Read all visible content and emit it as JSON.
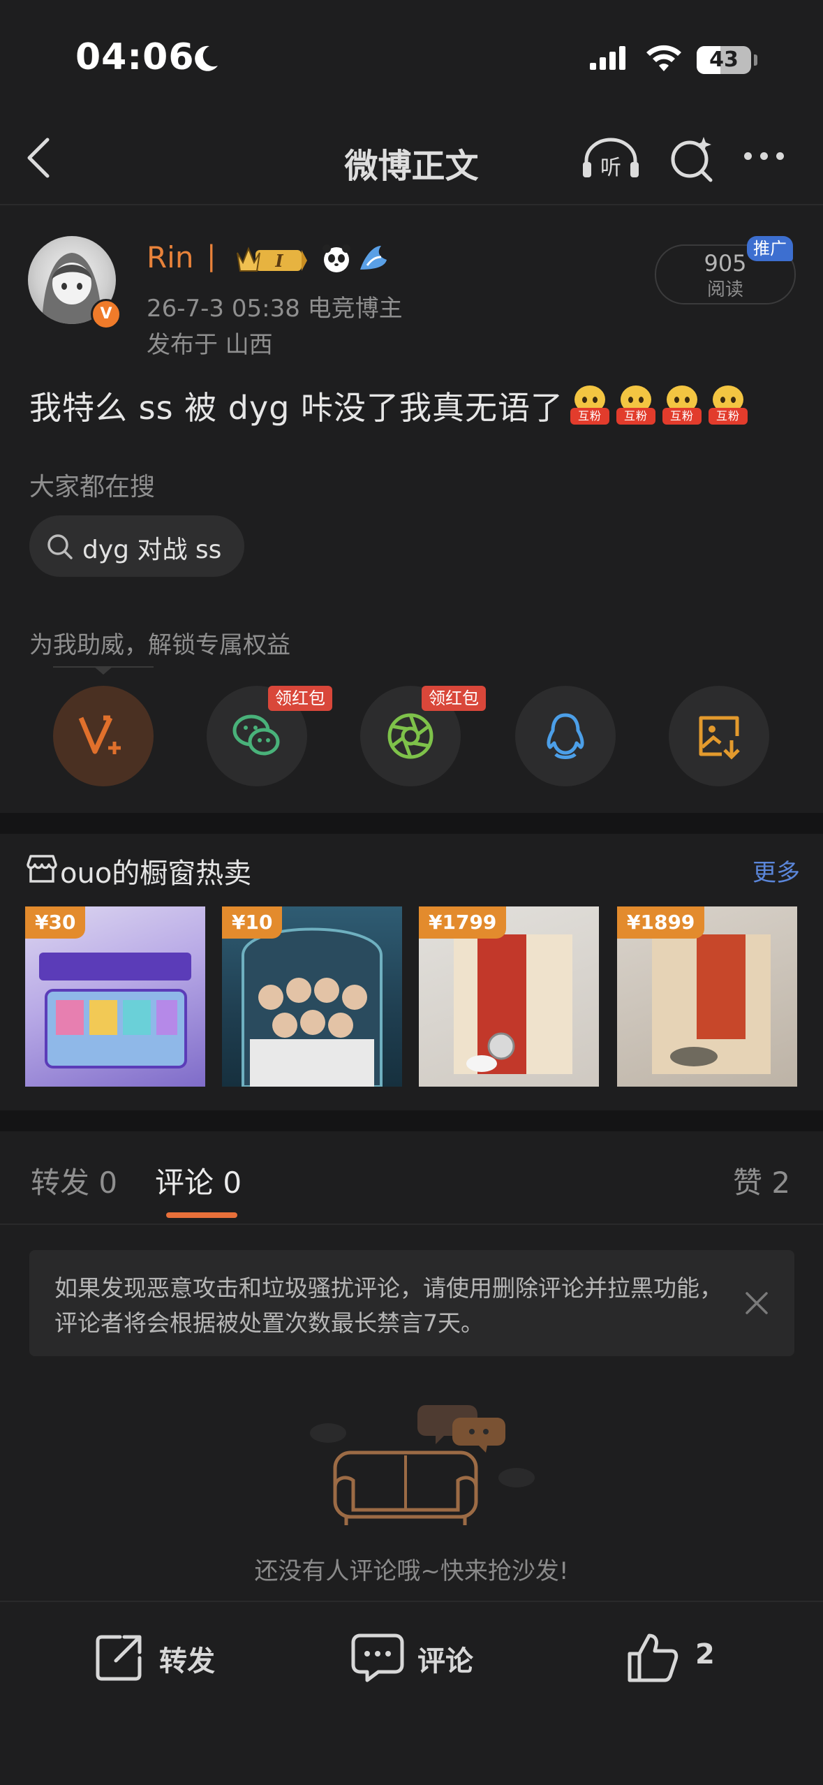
{
  "status_bar": {
    "time": "04:06",
    "battery": "43"
  },
  "nav": {
    "title": "微博正文"
  },
  "post": {
    "username": "Rin",
    "separator": "|",
    "meta": "26-7-3 05:38  电竞博主",
    "location": "发布于 山西",
    "read_count": "905",
    "read_label": "阅读",
    "ad_tag": "推广",
    "text": "我特么 ss 被 dyg 咔没了我真无语了",
    "emoji_label": "互粉",
    "emoji_count": 4
  },
  "search": {
    "title": "大家都在搜",
    "chip": "dyg 对战 ss"
  },
  "support": {
    "title": "为我助威，解锁专属权益",
    "redpack_label": "领红包"
  },
  "shop": {
    "title": "ouo的橱窗热卖",
    "more": "更多",
    "products": [
      {
        "price": "¥30"
      },
      {
        "price": "¥10"
      },
      {
        "price": "¥1799"
      },
      {
        "price": "¥1899"
      }
    ]
  },
  "tabs": {
    "repost": "转发 0",
    "comment": "评论 0",
    "like": "赞 2"
  },
  "notice": {
    "text": "如果发现恶意攻击和垃圾骚扰评论，请使用删除评论并拉黑功能，评论者将会根据被处置次数最长禁言7天。"
  },
  "empty": {
    "text": "还没有人评论哦~快来抢沙发!"
  },
  "bottom_bar": {
    "repost": "转发",
    "comment": "评论",
    "like": "2"
  },
  "colors": {
    "accent": "#e8823a",
    "link": "#5b86d9",
    "background": "#1e1e1f"
  }
}
